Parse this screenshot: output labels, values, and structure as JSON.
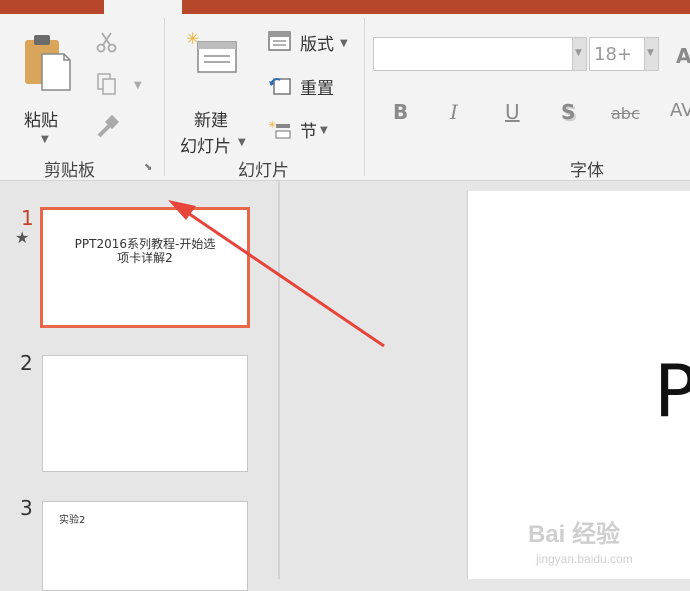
{
  "ribbon": {
    "clipboard": {
      "paste_label": "粘贴",
      "group_label": "剪贴板"
    },
    "slides": {
      "new_slide_line1": "新建",
      "new_slide_line2": "幻灯片",
      "layout_label": "版式",
      "reset_label": "重置",
      "section_label": "节",
      "group_label": "幻灯片"
    },
    "font": {
      "font_name_value": "",
      "font_size_value": "18+",
      "bold_label": "B",
      "italic_label": "I",
      "underline_label": "U",
      "shadow_label": "S",
      "strike_label": "abc",
      "spacing_label": "AV",
      "grow_label": "A",
      "group_label": "字体"
    }
  },
  "thumbnails": [
    {
      "number": "1",
      "text": "PPT2016系列教程-开始选项卡详解2"
    },
    {
      "number": "2",
      "text": ""
    },
    {
      "number": "3",
      "text": "实验2"
    }
  ],
  "slide": {
    "title_fragment": "P"
  },
  "watermark": {
    "text": "Bai 经验",
    "url": "jingyan.baidu.com"
  },
  "colors": {
    "accent": "#b7472a",
    "selection": "#e8664a",
    "arrow": "#e8443a"
  }
}
